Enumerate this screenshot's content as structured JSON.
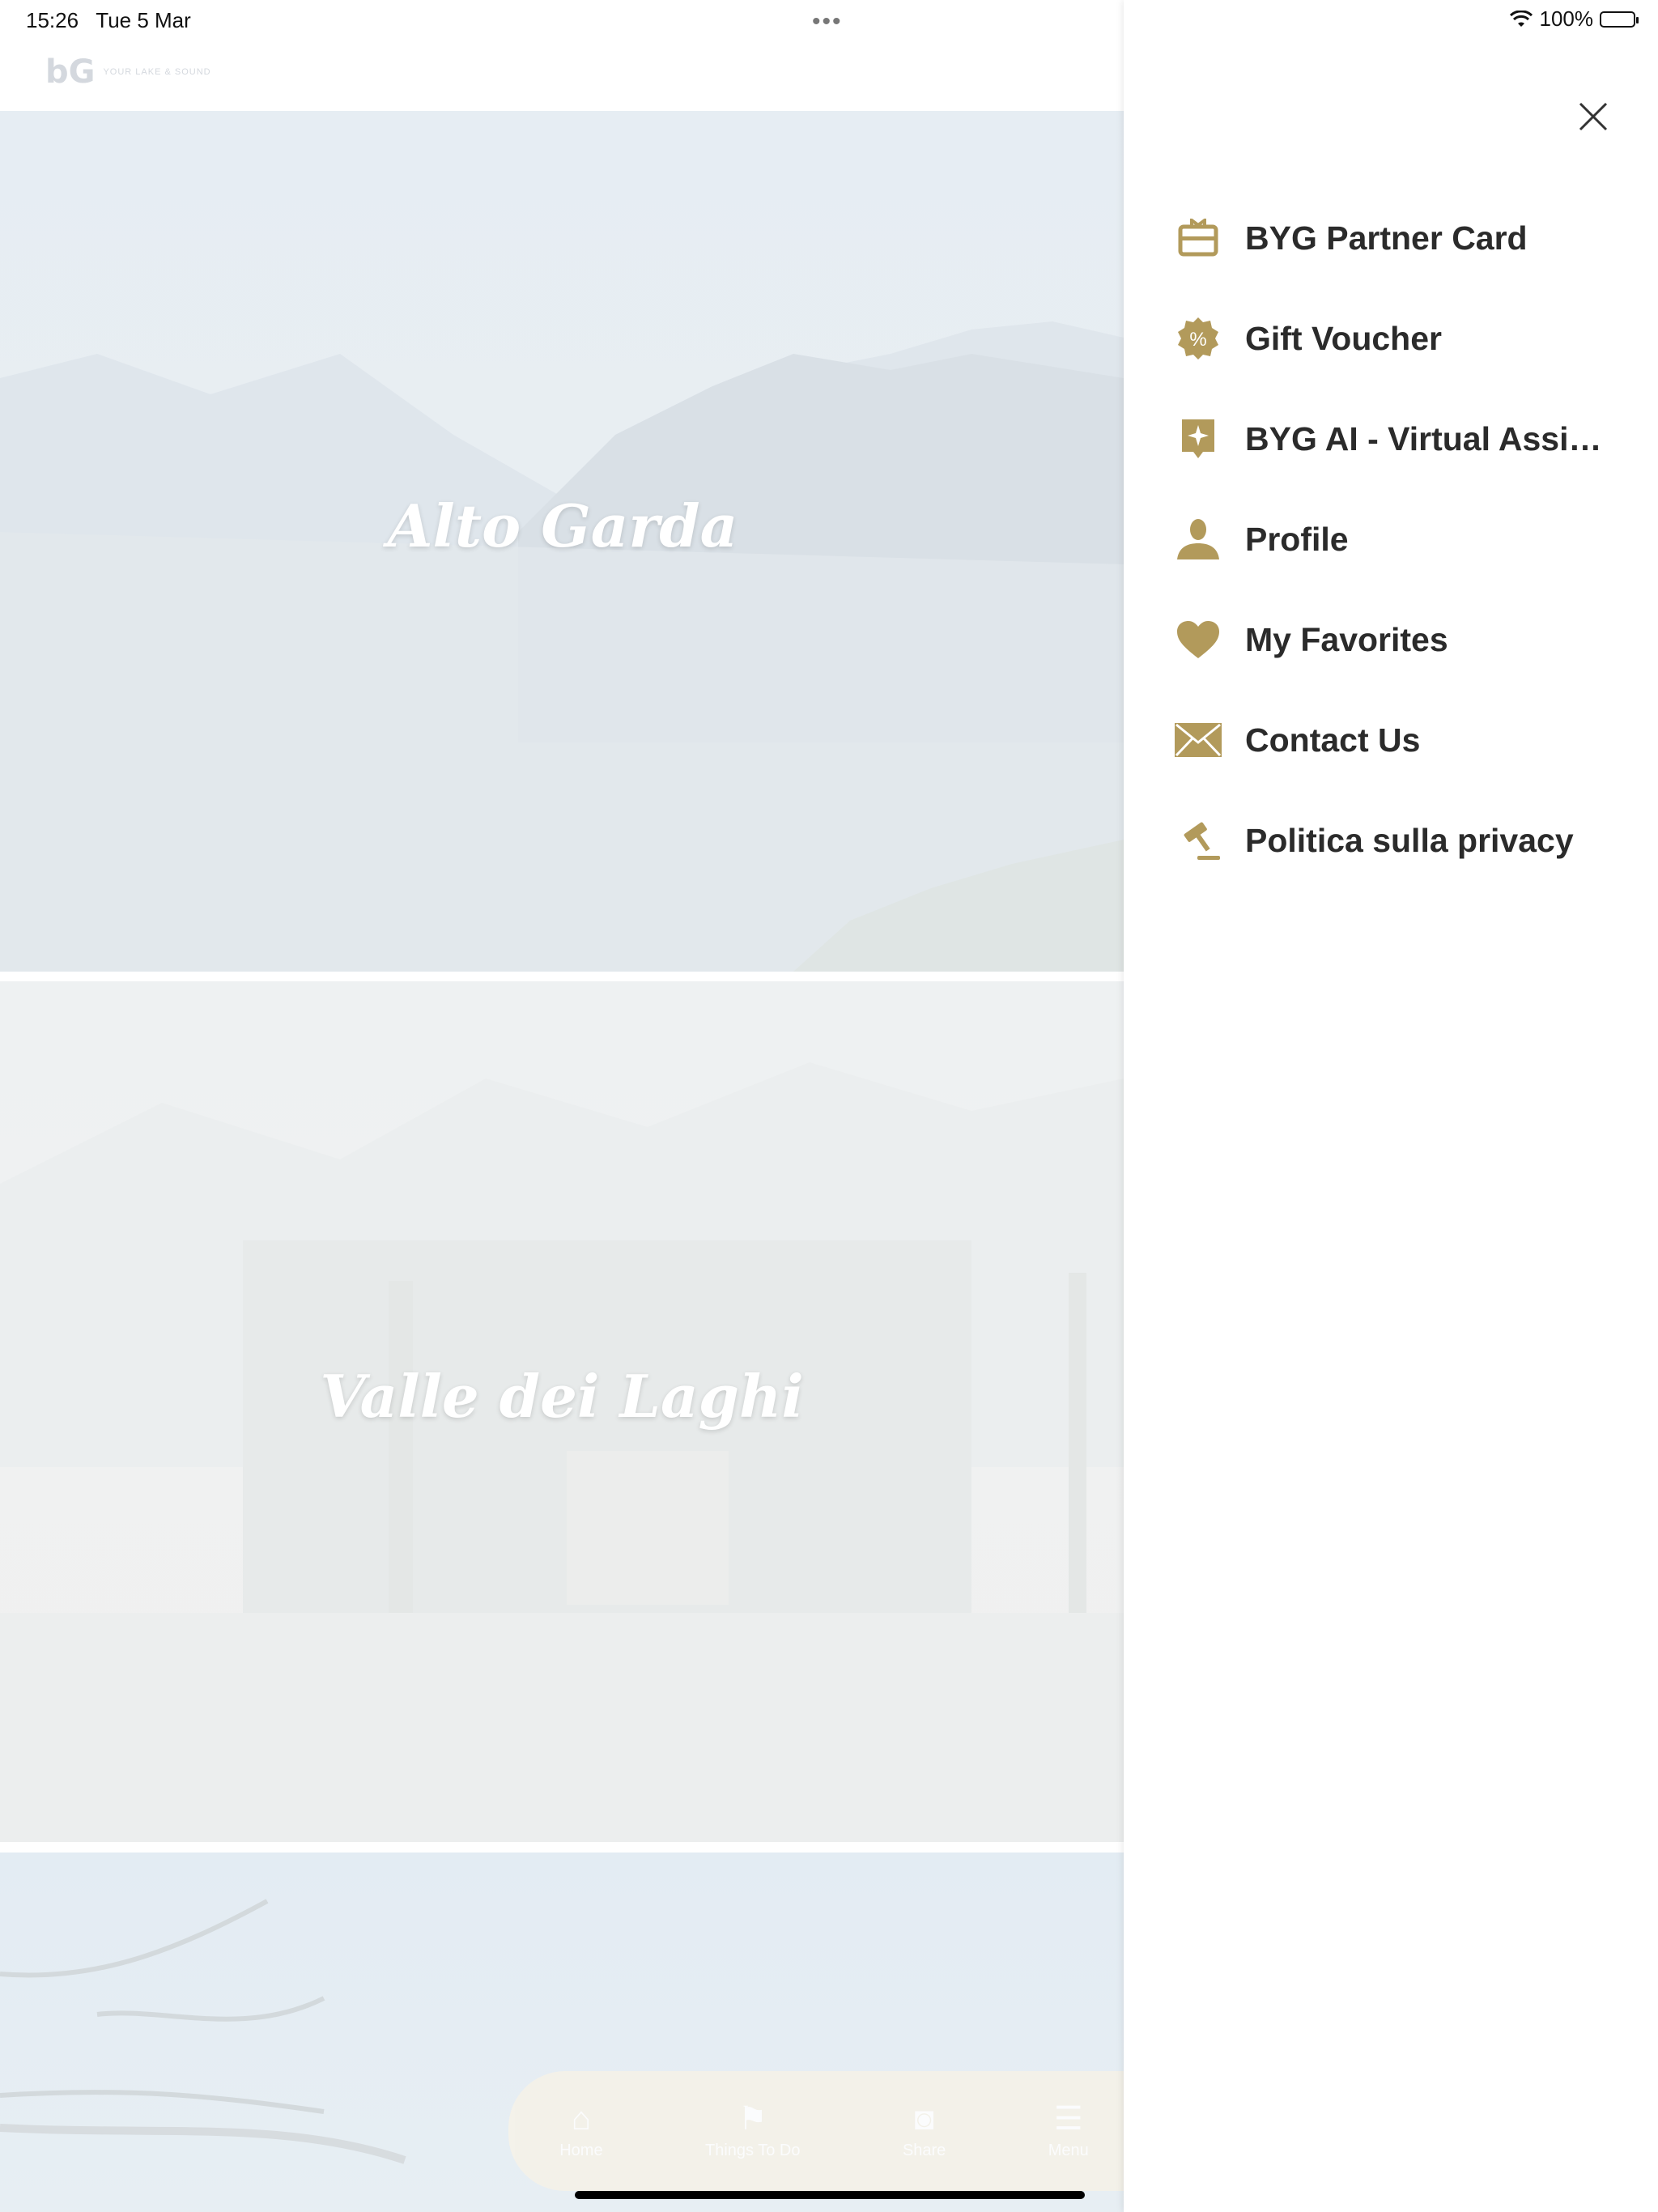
{
  "status_bar": {
    "time": "15:26",
    "date": "Tue 5 Mar",
    "dots": "•••",
    "battery": "100%"
  },
  "header": {
    "logo_mark": "bG",
    "logo_text": "YOUR LAKE & SOUND"
  },
  "cards": [
    {
      "title": "Alto Garda"
    },
    {
      "title": "Valle dei Laghi"
    }
  ],
  "tabbar": {
    "items": [
      {
        "label": "Home",
        "icon": "home-icon"
      },
      {
        "label": "Things To Do",
        "icon": "signpost-icon"
      },
      {
        "label": "Share",
        "icon": "camera-icon"
      },
      {
        "label": "Menu",
        "icon": "menu-icon"
      }
    ]
  },
  "drawer": {
    "accent": "#b29a5b",
    "items": [
      {
        "label": "BYG Partner Card",
        "icon": "partner-card-icon"
      },
      {
        "label": "Gift Voucher",
        "icon": "voucher-badge-icon"
      },
      {
        "label": "BYG AI - Virtual Assist...",
        "icon": "ai-sparkle-icon"
      },
      {
        "label": "Profile",
        "icon": "profile-icon"
      },
      {
        "label": "My Favorites",
        "icon": "heart-icon"
      },
      {
        "label": "Contact Us",
        "icon": "envelope-icon"
      },
      {
        "label": "Politica sulla privacy",
        "icon": "gavel-icon"
      }
    ]
  }
}
